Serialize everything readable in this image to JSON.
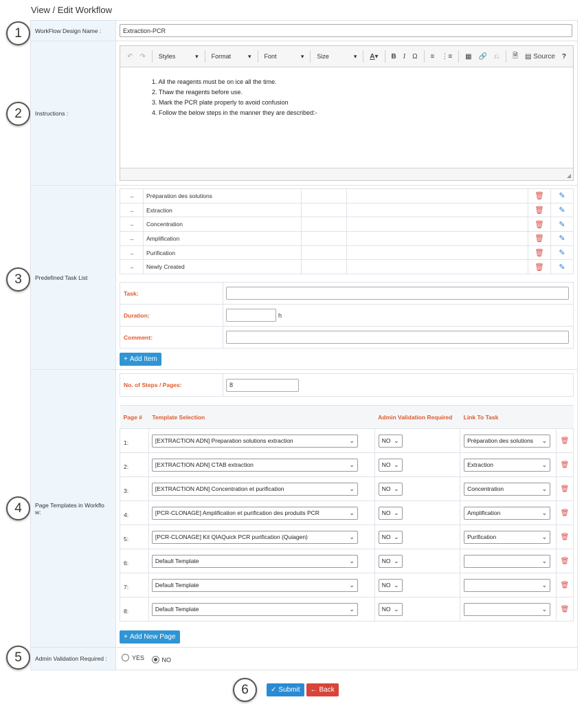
{
  "page": {
    "title": "View / Edit Workflow"
  },
  "markers": [
    "1",
    "2",
    "3",
    "4",
    "5",
    "6"
  ],
  "fields": {
    "design_name": {
      "label": "WorkFlow Design Name :",
      "value": "Extraction-PCR"
    },
    "instructions": {
      "label": "Instructions :"
    },
    "task_list": {
      "label": "Predefined Task List"
    },
    "page_templates": {
      "label": "Page Templates in Workflo w:"
    },
    "admin_validation": {
      "label": "Admin Validation Required :",
      "yes": "YES",
      "no": "NO",
      "selected": "NO"
    }
  },
  "editor": {
    "toolbar": {
      "styles": "Styles",
      "format": "Format",
      "font": "Font",
      "size": "Size",
      "source": "Source"
    },
    "lines": [
      "1. All the reagents must be on ice all the time.",
      "2. Thaw the reagents before use.",
      "3. Mark the PCR plate properly to avoid confusion",
      "4. Follow the below steps in the manner they are described:-"
    ]
  },
  "tasks": [
    "Préparation des solutions",
    "Extraction",
    "Concentration",
    "Amplification",
    "Purification",
    "Newly Created"
  ],
  "task_form": {
    "task_label": "Task:",
    "duration_label": "Duration:",
    "duration_unit": "h",
    "comment_label": "Comment:",
    "add_button": "Add Item"
  },
  "steps": {
    "label": "No. of Steps / Pages:",
    "value": "8"
  },
  "templates": {
    "headers": {
      "page": "Page #",
      "template": "Template Selection",
      "admin": "Admin Validation Required",
      "link": "Link To Task"
    },
    "rows": [
      {
        "page": "1:",
        "template": "[EXTRACTION ADN] Preparation solutions extraction",
        "admin": "NO",
        "link": "Préparation des solutions"
      },
      {
        "page": "2:",
        "template": "[EXTRACTION ADN] CTAB extraction",
        "admin": "NO",
        "link": "Extraction"
      },
      {
        "page": "3:",
        "template": "[EXTRACTION ADN] Concentration et purification",
        "admin": "NO",
        "link": "Concentration"
      },
      {
        "page": "4:",
        "template": "[PCR-CLONAGE] Amplification et purification des produits PCR",
        "admin": "NO",
        "link": "Amplification"
      },
      {
        "page": "5:",
        "template": "[PCR-CLONAGE] Kit QIAQuick PCR purification (Quiagen)",
        "admin": "NO",
        "link": "Purification"
      },
      {
        "page": "6:",
        "template": "Default Template",
        "admin": "NO",
        "link": ""
      },
      {
        "page": "7:",
        "template": "Default Template",
        "admin": "NO",
        "link": ""
      },
      {
        "page": "8:",
        "template": "Default Template",
        "admin": "NO",
        "link": ""
      }
    ],
    "add_button": "Add New Page"
  },
  "actions": {
    "submit": "Submit",
    "back": "Back"
  }
}
